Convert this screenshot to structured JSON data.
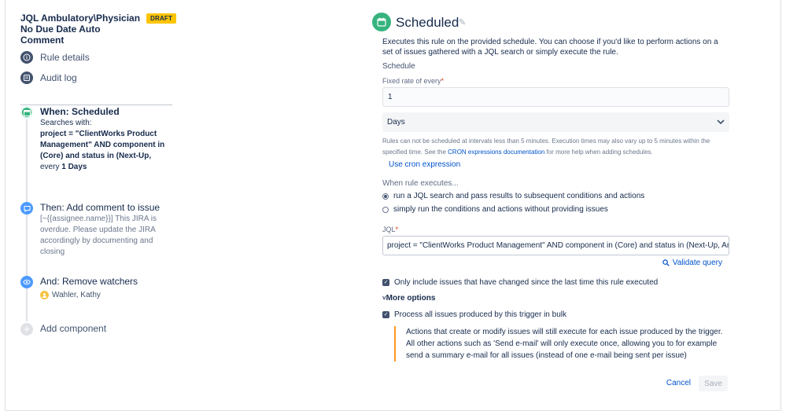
{
  "rule": {
    "title": "JQL Ambulatory\\Physician No Due Date Auto Comment",
    "status_badge": "DRAFT"
  },
  "sidebar_nav": {
    "rule_details": "Rule details",
    "audit_log": "Audit log"
  },
  "components": {
    "when": {
      "title": "When: Scheduled",
      "searches_label": "Searches with:",
      "query": "project = \"ClientWorks Product Management\" AND component in (Core) and status in (Next-Up,",
      "every_prefix": "every ",
      "every_value": "1 Days"
    },
    "then": {
      "title": "Then: Add comment to issue",
      "text": "[~{{assignee.name}}] This JIRA is overdue. Please update the JIRA accordingly by documenting and closing"
    },
    "and": {
      "title": "And: Remove watchers",
      "watcher": "Wahler, Kathy"
    },
    "add_component": "Add component"
  },
  "panel": {
    "title": "Scheduled",
    "description": "Executes this rule on the provided schedule. You can choose if you'd like to perform actions on a set of issues gathered with a JQL search or simply execute the rule.",
    "schedule_heading": "Schedule",
    "fixed_rate_label": "Fixed rate of every",
    "fixed_rate_value": "1",
    "unit_value": "Days",
    "note_before_link": "Rules can not be scheduled at intervals less than 5 minutes. Execution times may also vary up to 5 minutes within the specified time. See the ",
    "note_link": "CRON expressions documentation",
    "note_after_link": " for more help when adding schedules.",
    "use_cron": "Use cron expression",
    "when_executes": "When rule executes...",
    "radio_jql": "run a JQL search and pass results to subsequent conditions and actions",
    "radio_simple": "simply run the conditions and actions without providing issues",
    "jql_label": "JQL",
    "jql_value": "project = \"ClientWorks Product Management\" AND component in (Core) and status in (Next-Up, Analysis",
    "validate_query": "Validate query",
    "only_include": "Only include issues that have changed since the last time this rule executed",
    "more_options": "More options",
    "process_bulk": "Process all issues produced by this trigger in bulk",
    "callout": "Actions that create or modify issues will still execute for each issue produced by the trigger. All other actions such as 'Send e-mail' will only execute once, allowing you to for example send a summary e-mail for all issues (instead of one e-mail being sent per issue)",
    "cancel": "Cancel",
    "save": "Save"
  },
  "colors": {
    "draft_badge": "#ffc400",
    "scheduled_green": "#36b37e",
    "action_blue": "#4c9aff",
    "link_blue": "#0052cc",
    "callout_orange": "#ff991f"
  },
  "icons": [
    "info-icon",
    "list-icon",
    "calendar-icon",
    "comment-icon",
    "eye-icon",
    "plus-icon",
    "pencil-icon",
    "chevron-down-icon",
    "search-icon",
    "checkbox-checked-icon"
  ]
}
